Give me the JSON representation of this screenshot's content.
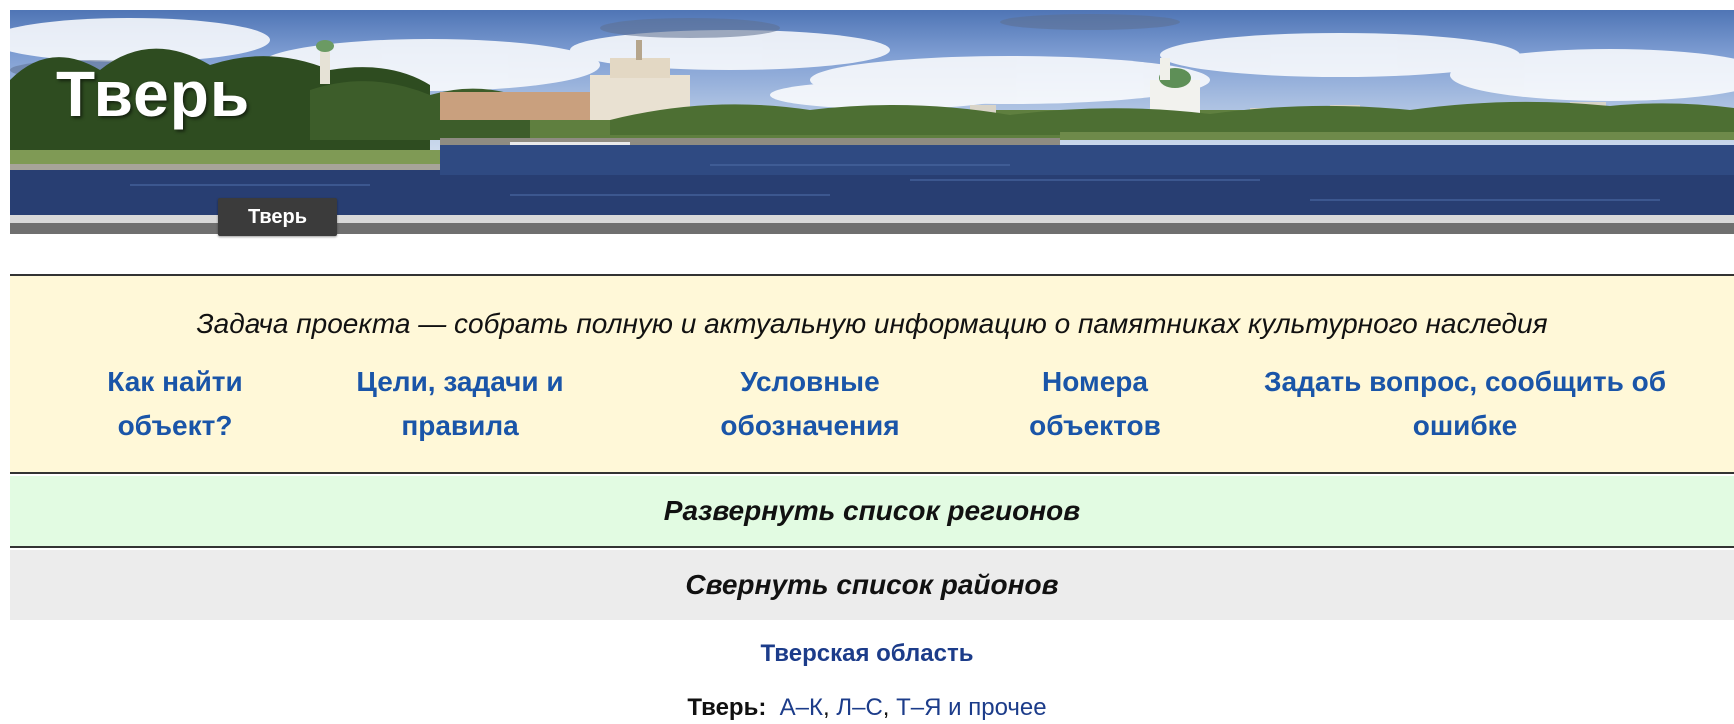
{
  "banner": {
    "title": "Тверь",
    "tab_label": "Тверь"
  },
  "info": {
    "mission": "Задача проекта — собрать полную и актуальную информацию о памятниках культурного наследия",
    "links": [
      {
        "line1": "Как найти",
        "line2": "объект?"
      },
      {
        "line1": "Цели, задачи и",
        "line2": "правила"
      },
      {
        "line1": "Условные",
        "line2": "обозначения"
      },
      {
        "line1": "Номера",
        "line2": "объектов"
      },
      {
        "line1": "Задать вопрос, сообщить об",
        "line2": "ошибке"
      }
    ]
  },
  "toggles": {
    "regions": "Развернуть список регионов",
    "districts": "Свернуть список районов"
  },
  "region": {
    "oblast": "Тверская область",
    "city_label": "Тверь:",
    "city_links": [
      "А–К",
      "Л–С",
      "Т–Я и прочее"
    ],
    "separator": ", ",
    "conjunction": " и "
  },
  "colors": {
    "info_bg": "#fff8d8",
    "regions_bg": "#e2fbe2",
    "districts_bg": "#ececec",
    "link": "#1a55a8"
  }
}
